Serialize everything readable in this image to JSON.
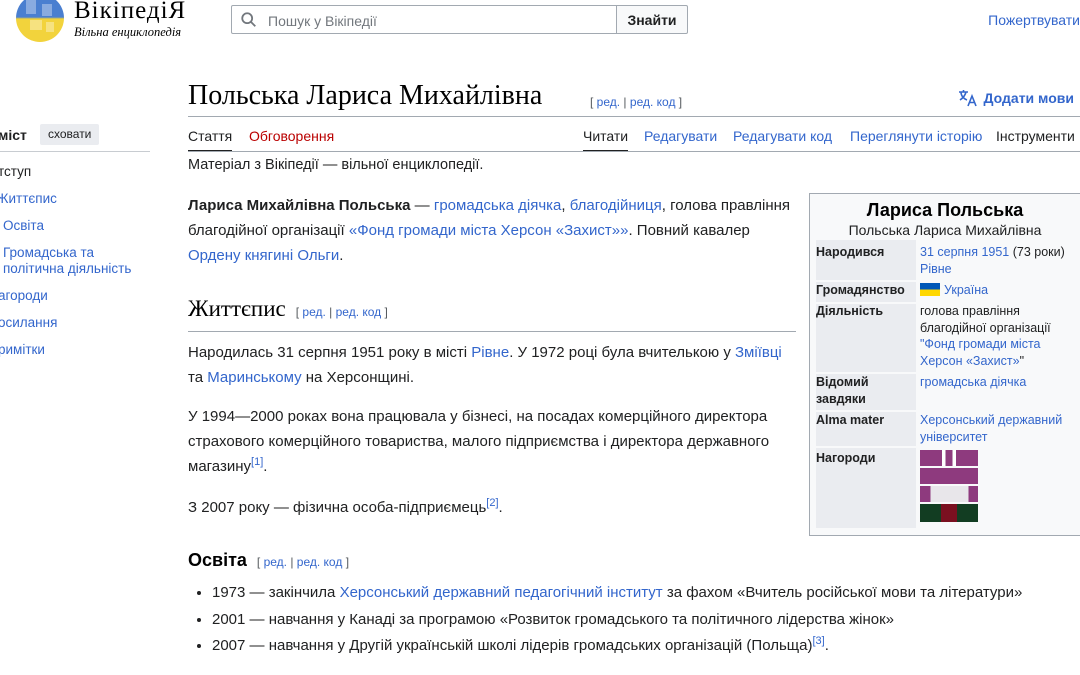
{
  "header": {
    "logo_word": "ВікіпедіЯ",
    "logo_tagline": "Вільна енциклопедія",
    "search_placeholder": "Пошук у Вікіпедії",
    "search_button": "Знайти",
    "donate": "Пожертвувати"
  },
  "title": {
    "text": "Польська Лариса Михайлівна",
    "edit": "ред.",
    "edit_code": "ред. код",
    "langs": "Додати мови"
  },
  "tabs": {
    "left": [
      "Стаття",
      "Обговорення"
    ],
    "right": [
      "Читати",
      "Редагувати",
      "Редагувати код",
      "Переглянути історію",
      "Інструменти"
    ]
  },
  "toc": {
    "heading": "міст",
    "hide": "сховати",
    "items": [
      "тступ",
      "Життєпис",
      "Освіта",
      "Громадська та",
      "політична діяльність",
      "агороди",
      "осилання",
      "римітки"
    ]
  },
  "content": {
    "from": "Матеріал з Вікіпедії — вільної енциклопедії.",
    "intro": {
      "bold": "Лариса Михайлівна Польська",
      "dash": " — ",
      "l1": "громадська діячка",
      "comma": ", ",
      "l2": "благодійниця",
      "t1": ", голова правління благодійної організації ",
      "l3": "«Фонд громади міста Херсон «Захист»»",
      "t2": ". Повний кавалер ",
      "l4": "Ордену княгині Ольги",
      "t3": "."
    },
    "bio_heading": "Життєпис",
    "bio1": {
      "t1": "Народилась 31 серпня 1951 року в місті ",
      "l1": "Рівне",
      "t2": ". У 1972 році була вчителькою у ",
      "l2": "Зміївці",
      "t3": " та ",
      "l3": "Маринському",
      "t4": " на Херсонщині."
    },
    "bio2": {
      "t1": "У 1994—2000 роках вона працювала у бізнесі, на посадах комерційного директора страхового комерційного товариства, малого підприємства і директора державного магазину",
      "ref": "[1]",
      "t2": "."
    },
    "bio3": {
      "t1": "З 2007 року — фізична особа-підприємець",
      "ref": "[2]",
      "t2": "."
    },
    "edu_heading": "Освіта",
    "edu": {
      "i1_t1": "1973 — закінчила ",
      "i1_link": "Херсонський державний педагогічний інститут",
      "i1_t2": " за фахом «Вчитель російської мови та літератури»",
      "i2": "2001 — навчання у Канаді за програмою «Розвиток громадського та політичного лідерства жінок»",
      "i3_t1": "2007 — навчання у Другій українській школі лідерів громадських організацій (Польща)",
      "i3_ref": "[3]",
      "i3_t2": "."
    },
    "section_edit": "ред.",
    "section_edit_code": "ред. код"
  },
  "infobox": {
    "name": "Лариса Польська",
    "full_name": "Польська Лариса Михайлівна",
    "born_label": "Народився",
    "born_date": "31 серпня 1951",
    "born_age": " (73 роки)",
    "born_place": "Рівне",
    "citizenship_label": "Громадянство",
    "citizenship": "Україна",
    "activity_label": "Діяльність",
    "activity_t1": "голова правління благодійної організації ",
    "activity_link": "\"Фонд громади міста Херсон «Захист»",
    "activity_t2": "\"",
    "known_label": "Відомий завдяки",
    "known": "громадська діячка",
    "alma_label": "Alma mater",
    "alma": "Херсонський державний університет",
    "awards_label": "Нагороди",
    "colors": {
      "ua_blue": "#0057b7",
      "ua_yellow": "#ffd700",
      "ribbon_purple": "#8e3a7e",
      "ribbon_green": "#123d22",
      "ribbon_red": "#7a1020"
    }
  },
  "colors": {
    "link": "#3366cc",
    "talk_link": "#ba0000",
    "text": "#202122"
  }
}
